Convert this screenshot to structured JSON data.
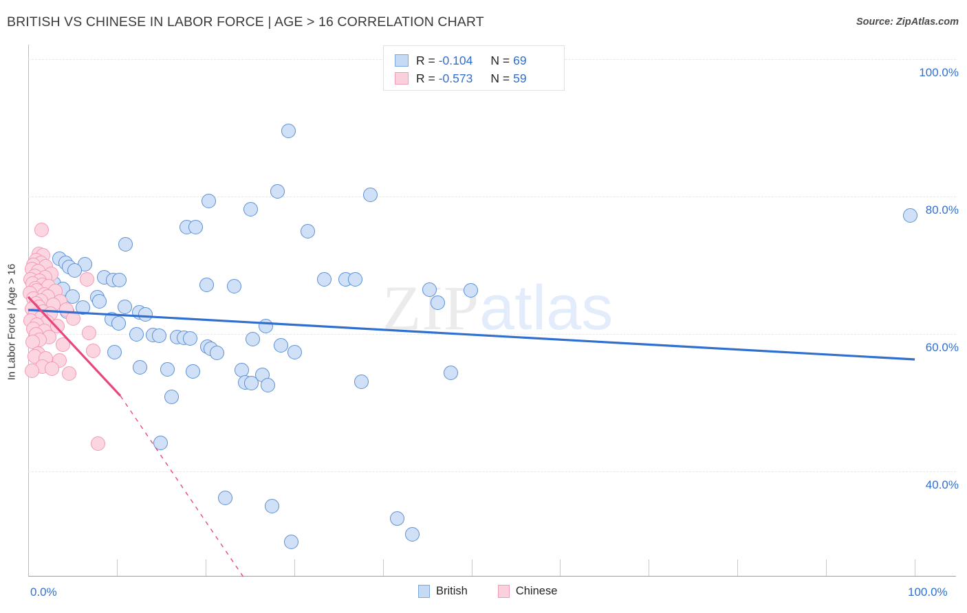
{
  "header": {
    "title": "BRITISH VS CHINESE IN LABOR FORCE | AGE > 16 CORRELATION CHART",
    "source": "Source: ZipAtlas.com"
  },
  "watermark": {
    "part1": "ZIP",
    "part2": "atlas"
  },
  "axes": {
    "y_title": "In Labor Force | Age > 16",
    "y_ticks": [
      "100.0%",
      "80.0%",
      "60.0%",
      "40.0%"
    ],
    "x_min_label": "0.0%",
    "x_max_label": "100.0%"
  },
  "stat_legend": {
    "rows": [
      {
        "series": "British",
        "r_label": "R =",
        "r_value": "-0.104",
        "n_label": "N =",
        "n_value": "69",
        "color": "#c5dbf5"
      },
      {
        "series": "Chinese",
        "r_label": "R =",
        "r_value": "-0.573",
        "n_label": "N =",
        "n_value": "59",
        "color": "#fbd0dd"
      }
    ]
  },
  "series_legend": {
    "items": [
      {
        "label": "British",
        "color": "#c5dbf5"
      },
      {
        "label": "Chinese",
        "color": "#fbd0dd"
      }
    ]
  },
  "chart_data": {
    "type": "scatter",
    "title": "BRITISH VS CHINESE IN LABOR FORCE | AGE > 16 CORRELATION CHART",
    "xlabel": "",
    "ylabel": "In Labor Force | Age > 16",
    "xlim": [
      0,
      100
    ],
    "ylim": [
      24.8,
      102.1
    ],
    "x_ticks": [
      0,
      10,
      20,
      30,
      40,
      50,
      60,
      70,
      80,
      90,
      100
    ],
    "y_ticks": [
      40,
      60,
      80,
      100
    ],
    "y_tick_labels": [
      "40.0%",
      "60.0%",
      "80.0%",
      "100.0%"
    ],
    "x_tick_labels_shown": [
      "0.0%",
      "100.0%"
    ],
    "grid": "horizontal-dashed",
    "legend_position": "top-center and bottom-center",
    "colors": {
      "british_fill": "#cfe0f7",
      "british_stroke": "#5b8fd4",
      "chinese_fill": "#fbd6e0",
      "chinese_stroke": "#f598b5",
      "british_trend": "#2f6fd0",
      "chinese_trend": "#e8467c",
      "axis_text": "#2f6fd0",
      "gridline": "#e6e6e6"
    },
    "series": [
      {
        "name": "British",
        "r": -0.104,
        "n": 69,
        "marker_color": "#cfe0f7",
        "trendline": {
          "x0": 0,
          "y0": 63.5,
          "x1": 100,
          "y1": 56.3,
          "style": "solid"
        },
        "points": [
          [
            29.4,
            89.6
          ],
          [
            20.4,
            79.4
          ],
          [
            28.1,
            80.8
          ],
          [
            38.6,
            80.3
          ],
          [
            25.1,
            78.2
          ],
          [
            99.5,
            77.3
          ],
          [
            17.9,
            75.6
          ],
          [
            18.9,
            75.6
          ],
          [
            31.5,
            75.0
          ],
          [
            11.0,
            73.1
          ],
          [
            3.5,
            71.0
          ],
          [
            4.2,
            70.4
          ],
          [
            6.4,
            70.2
          ],
          [
            4.6,
            69.8
          ],
          [
            5.2,
            69.3
          ],
          [
            33.4,
            68.0
          ],
          [
            35.8,
            68.0
          ],
          [
            36.9,
            68.0
          ],
          [
            8.6,
            68.3
          ],
          [
            9.6,
            67.9
          ],
          [
            10.3,
            67.9
          ],
          [
            20.1,
            67.2
          ],
          [
            23.2,
            67.0
          ],
          [
            45.3,
            66.5
          ],
          [
            49.9,
            66.4
          ],
          [
            46.2,
            64.6
          ],
          [
            7.8,
            65.4
          ],
          [
            2.9,
            67.4
          ],
          [
            3.9,
            66.6
          ],
          [
            5.0,
            65.5
          ],
          [
            8.0,
            64.8
          ],
          [
            10.9,
            64.0
          ],
          [
            12.5,
            63.2
          ],
          [
            13.2,
            62.9
          ],
          [
            6.2,
            63.9
          ],
          [
            4.4,
            63.3
          ],
          [
            9.4,
            62.2
          ],
          [
            10.2,
            61.6
          ],
          [
            26.8,
            61.2
          ],
          [
            12.2,
            60.0
          ],
          [
            14.1,
            59.9
          ],
          [
            14.8,
            59.8
          ],
          [
            16.8,
            59.6
          ],
          [
            17.6,
            59.5
          ],
          [
            18.3,
            59.4
          ],
          [
            25.3,
            59.3
          ],
          [
            28.5,
            58.4
          ],
          [
            20.2,
            58.2
          ],
          [
            9.7,
            57.4
          ],
          [
            20.6,
            57.9
          ],
          [
            21.3,
            57.3
          ],
          [
            30.1,
            57.4
          ],
          [
            12.6,
            55.2
          ],
          [
            15.7,
            54.9
          ],
          [
            18.6,
            54.6
          ],
          [
            24.1,
            54.8
          ],
          [
            26.4,
            54.1
          ],
          [
            47.7,
            54.4
          ],
          [
            24.5,
            53.0
          ],
          [
            25.2,
            52.9
          ],
          [
            27.0,
            52.6
          ],
          [
            37.6,
            53.1
          ],
          [
            16.2,
            50.9
          ],
          [
            14.9,
            44.2
          ],
          [
            22.2,
            36.2
          ],
          [
            27.5,
            35.0
          ],
          [
            41.6,
            33.2
          ],
          [
            43.3,
            30.9
          ],
          [
            29.7,
            29.8
          ]
        ]
      },
      {
        "name": "Chinese",
        "r": -0.573,
        "n": 59,
        "marker_color": "#fbd6e0",
        "trendline": {
          "x0": 0,
          "y0": 65.4,
          "x1": 10.4,
          "y1": 51.0,
          "style": "solid-then-dashed",
          "dash_to_x": 24.4,
          "dash_to_y": 24.4
        },
        "points": [
          [
            1.5,
            75.2
          ],
          [
            1.2,
            71.7
          ],
          [
            1.7,
            71.5
          ],
          [
            0.9,
            70.8
          ],
          [
            1.4,
            70.4
          ],
          [
            0.6,
            70.1
          ],
          [
            2.0,
            69.9
          ],
          [
            0.4,
            69.5
          ],
          [
            1.1,
            69.2
          ],
          [
            2.6,
            68.8
          ],
          [
            0.7,
            68.5
          ],
          [
            1.9,
            68.3
          ],
          [
            0.3,
            68.0
          ],
          [
            1.3,
            67.8
          ],
          [
            6.6,
            68.0
          ],
          [
            0.5,
            67.4
          ],
          [
            1.6,
            67.2
          ],
          [
            2.3,
            67.0
          ],
          [
            0.8,
            66.7
          ],
          [
            1.0,
            66.4
          ],
          [
            3.1,
            66.3
          ],
          [
            0.2,
            66.0
          ],
          [
            1.8,
            65.8
          ],
          [
            2.2,
            65.5
          ],
          [
            0.6,
            65.2
          ],
          [
            1.4,
            64.9
          ],
          [
            3.6,
            64.8
          ],
          [
            0.9,
            64.5
          ],
          [
            2.8,
            64.3
          ],
          [
            1.2,
            64.0
          ],
          [
            0.4,
            63.7
          ],
          [
            4.3,
            63.6
          ],
          [
            1.7,
            63.3
          ],
          [
            2.5,
            63.0
          ],
          [
            0.7,
            62.8
          ],
          [
            1.5,
            62.5
          ],
          [
            5.1,
            62.3
          ],
          [
            0.3,
            62.0
          ],
          [
            2.1,
            61.8
          ],
          [
            1.0,
            61.4
          ],
          [
            3.3,
            61.2
          ],
          [
            0.6,
            60.8
          ],
          [
            1.8,
            60.5
          ],
          [
            6.9,
            60.2
          ],
          [
            0.9,
            60.0
          ],
          [
            2.4,
            59.6
          ],
          [
            1.3,
            59.2
          ],
          [
            0.5,
            58.9
          ],
          [
            3.9,
            58.5
          ],
          [
            7.3,
            57.6
          ],
          [
            1.1,
            57.2
          ],
          [
            0.7,
            56.8
          ],
          [
            2.0,
            56.5
          ],
          [
            3.5,
            56.2
          ],
          [
            1.6,
            55.3
          ],
          [
            2.7,
            55.0
          ],
          [
            0.4,
            54.7
          ],
          [
            4.6,
            54.3
          ],
          [
            7.9,
            44.1
          ]
        ]
      }
    ]
  }
}
